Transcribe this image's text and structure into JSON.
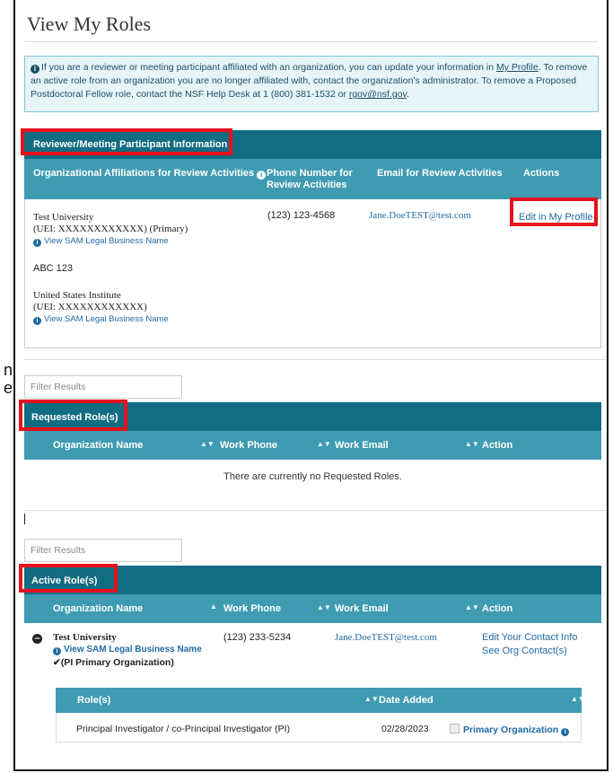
{
  "page": {
    "title": "View My Roles"
  },
  "edge_fragments": [
    "n",
    "e"
  ],
  "info": {
    "text_before": "If you are a reviewer or meeting participant affiliated with an organization, you can update your information in ",
    "profile_link": "My Profile",
    "text_middle": ". To remove an active role from an organization you are no longer affiliated with, contact the organization's administrator. To remove a Proposed Postdoctoral Fellow role, contact the NSF Help Desk at 1 (800) 381-1532 or ",
    "email_link": "rgov@nsf.gov",
    "text_after": "."
  },
  "reviewer": {
    "heading": "Reviewer/Meeting Participant Information",
    "columns": {
      "affiliations": "Organizational Affiliations for Review Activities",
      "phone": "Phone Number for Review Activities",
      "email": "Email for Review Activities",
      "actions": "Actions"
    },
    "org1_name": "Test University",
    "org1_uei": "(UEI: XXXXXXXXXXXX) (Primary)",
    "sam_link": "View SAM Legal Business Name",
    "org2_name": "ABC 123",
    "org3_name": "United States Institute",
    "org3_uei": "(UEI: XXXXXXXXXXXX)",
    "phone": "(123) 123-4568",
    "email": "Jane.DoeTEST@test.com",
    "edit_link": "Edit in My Profile"
  },
  "requested": {
    "filter_placeholder": "Filter Results",
    "heading": "Requested Role(s)",
    "columns": {
      "org": "Organization Name",
      "phone": "Work Phone",
      "email": "Work Email",
      "action": "Action"
    },
    "empty_text": "There are currently no Requested Roles."
  },
  "active": {
    "filter_placeholder": "Filter Results",
    "heading": "Active Role(s)",
    "columns": {
      "org": "Organization Name",
      "phone": "Work Phone",
      "email": "Work Email",
      "action": "Action"
    },
    "row": {
      "org_name": "Test University",
      "sam_link": "View SAM Legal Business Name",
      "primary_label": "(PI Primary Organization)",
      "phone": "(123) 233-5234",
      "email": "Jane.DoeTEST@test.com",
      "action_edit": "Edit Your Contact Info",
      "action_see": "See Org Contact(s)"
    },
    "roles_table": {
      "columns": {
        "role": "Role(s)",
        "date": "Date Added"
      },
      "rows": [
        {
          "role": "Principal Investigator / co-Principal Investigator (PI)",
          "date": "02/28/2023",
          "primary": "Primary Organization"
        }
      ]
    }
  },
  "colors": {
    "panel_header": "#126c82",
    "column_header": "#3f9bb2",
    "info_background": "#e7f4f8",
    "highlight": "#e8101c",
    "link": "#1f6aa5"
  }
}
